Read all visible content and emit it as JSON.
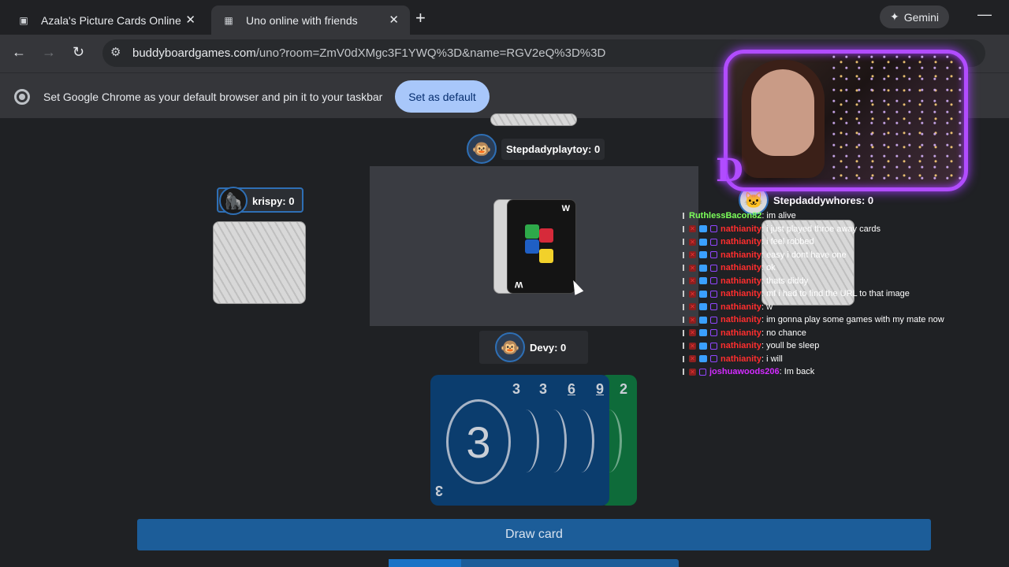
{
  "browser": {
    "tabs": [
      {
        "title": "Azala's Picture Cards Online",
        "active": false
      },
      {
        "title": "Uno online with friends",
        "active": true
      }
    ],
    "gemini_label": "Gemini",
    "url_host": "buddyboardgames.com",
    "url_rest": "/uno?room=ZmV0dXMgc3F1YWQ%3D&name=RGV2eQ%3D%3D",
    "infobar_text": "Set Google Chrome as your default browser and pin it to your taskbar",
    "infobar_button": "Set as default"
  },
  "game": {
    "players": {
      "top": {
        "name": "Stepdadyplaytoy: 0",
        "avatar": "monkey-icon"
      },
      "left": {
        "name": "krispy: 0",
        "avatar": "gorilla-icon"
      },
      "right": {
        "name": "Stepdaddywhores: 0",
        "avatar": "cat-icon"
      },
      "bottom": {
        "name": "Devy: 0",
        "avatar": "monkey-icon"
      }
    },
    "discard_top": {
      "type": "wild",
      "corner_label": "W"
    },
    "hand": [
      {
        "value": "3",
        "color": "#0b3d6e"
      },
      {
        "value": "3",
        "color": "#0b3d6e"
      },
      {
        "value": "6",
        "color": "#0b3d6e"
      },
      {
        "value": "9",
        "color": "#0b3d6e"
      },
      {
        "value": "2",
        "color": "#0e6b3a"
      }
    ],
    "draw_button": "Draw card"
  },
  "chat": [
    {
      "user": "RuthlessBacon82",
      "text": ": im alive",
      "color": "#7cff5a"
    },
    {
      "user": "nathianity",
      "text": ": i just played throe away cards",
      "color": "#ff2e2e"
    },
    {
      "user": "nathianity",
      "text": ": i feel robbed",
      "color": "#ff2e2e"
    },
    {
      "user": "nathianity",
      "text": ": easy i dont have one",
      "color": "#ff2e2e"
    },
    {
      "user": "nathianity",
      "text": ": ok",
      "color": "#ff2e2e"
    },
    {
      "user": "nathianity",
      "text": ": thats diddy",
      "color": "#ff2e2e"
    },
    {
      "user": "nathianity",
      "text": ": mf i had to find the URL to that image",
      "color": "#ff2e2e"
    },
    {
      "user": "nathianity",
      "text": ": w",
      "color": "#ff2e2e"
    },
    {
      "user": "nathianity",
      "text": ": im gonna play some games with my mate now",
      "color": "#ff2e2e"
    },
    {
      "user": "nathianity",
      "text": ": no chance",
      "color": "#ff2e2e"
    },
    {
      "user": "nathianity",
      "text": ": youll be sleep",
      "color": "#ff2e2e"
    },
    {
      "user": "nathianity",
      "text": ": i will",
      "color": "#ff2e2e"
    },
    {
      "user": "joshuawoods206",
      "text": ": Im back",
      "color": "#d22bff"
    }
  ],
  "webcam": {
    "logo": "D"
  }
}
